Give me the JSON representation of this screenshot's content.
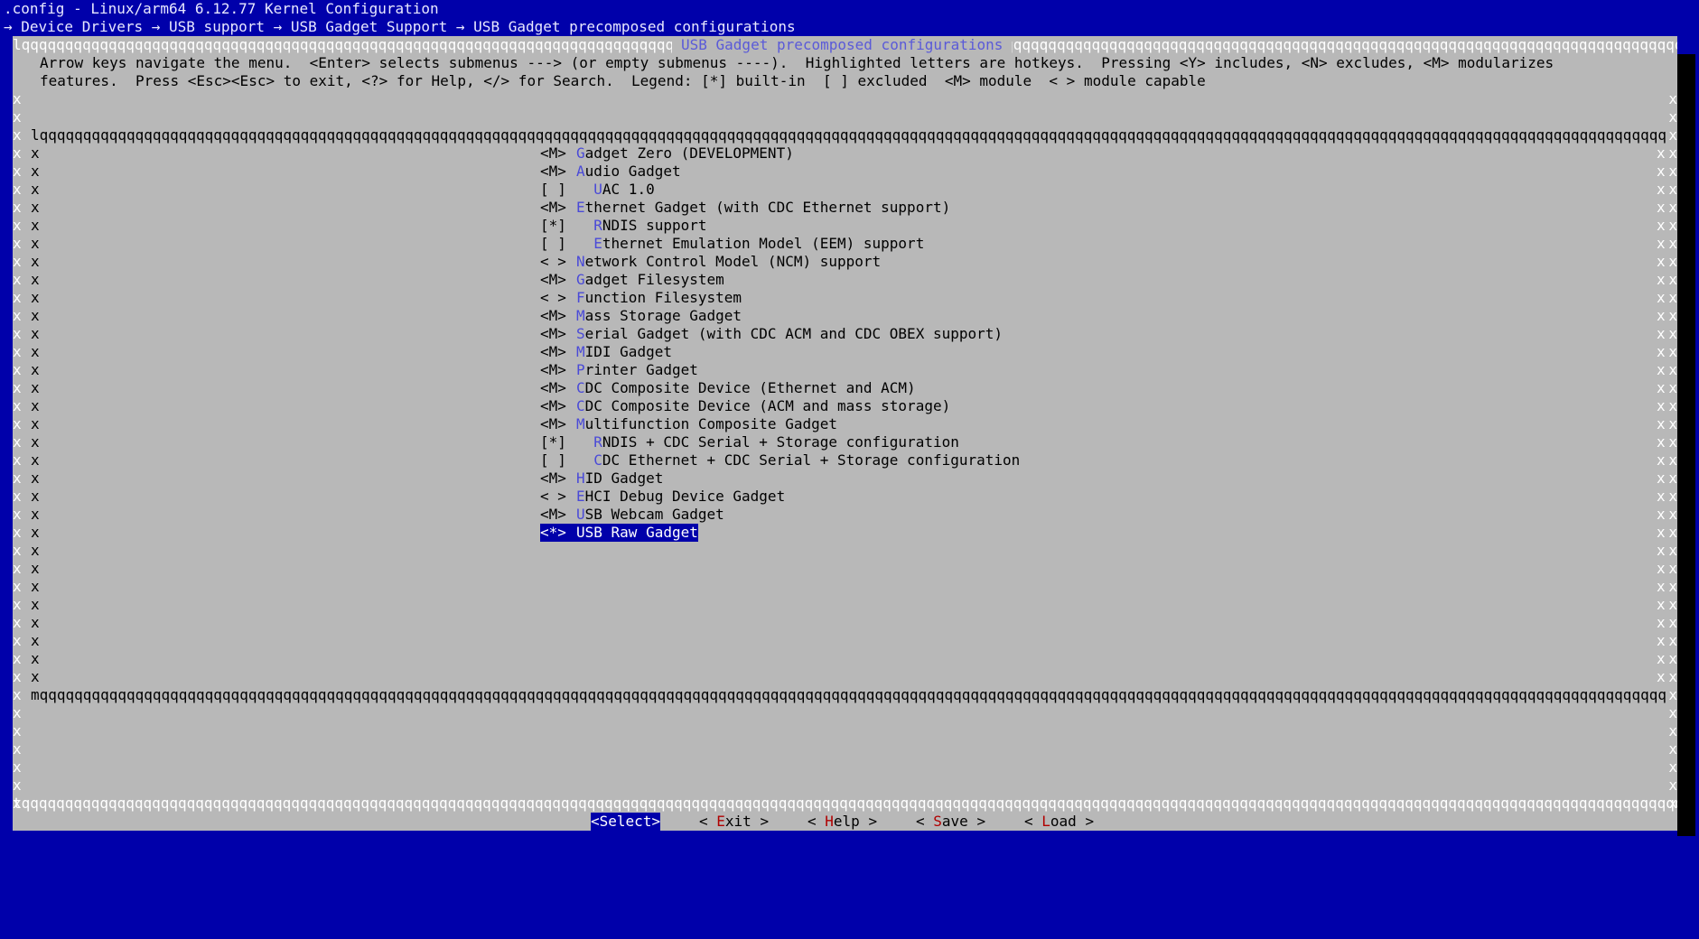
{
  "window": {
    "title": ".config - Linux/arm64 6.12.77 Kernel Configuration",
    "breadcrumb": "→ Device Drivers → USB support → USB Gadget Support → USB Gadget precomposed configurations"
  },
  "dialog": {
    "title": "USB Gadget precomposed configurations",
    "help_line_1": "Arrow keys navigate the menu.  <Enter> selects submenus ---> (or empty submenus ----).  Highlighted letters are hotkeys.  Pressing <Y> includes, <N> excludes, <M> modularizes",
    "help_line_2": "features.  Press <Esc><Esc> to exit, <?> for Help, </> for Search.  Legend: [*] built-in  [ ] excluded  <M> module  < > module capable"
  },
  "menu": {
    "items": [
      {
        "state": "<M>",
        "indent": "",
        "hotkey": "G",
        "rest": "adget Zero (DEVELOPMENT)"
      },
      {
        "state": "<M>",
        "indent": "",
        "hotkey": "A",
        "rest": "udio Gadget"
      },
      {
        "state": "[ ]",
        "indent": "  ",
        "hotkey": "U",
        "rest": "AC 1.0"
      },
      {
        "state": "<M>",
        "indent": "",
        "hotkey": "E",
        "rest": "thernet Gadget (with CDC Ethernet support)"
      },
      {
        "state": "[*]",
        "indent": "  ",
        "hotkey": "R",
        "rest": "NDIS support"
      },
      {
        "state": "[ ]",
        "indent": "  ",
        "hotkey": "E",
        "rest": "thernet Emulation Model (EEM) support"
      },
      {
        "state": "< >",
        "indent": "",
        "hotkey": "N",
        "rest": "etwork Control Model (NCM) support"
      },
      {
        "state": "<M>",
        "indent": "",
        "hotkey": "G",
        "rest": "adget Filesystem"
      },
      {
        "state": "< >",
        "indent": "",
        "hotkey": "F",
        "rest": "unction Filesystem"
      },
      {
        "state": "<M>",
        "indent": "",
        "hotkey": "M",
        "rest": "ass Storage Gadget"
      },
      {
        "state": "<M>",
        "indent": "",
        "hotkey": "S",
        "rest": "erial Gadget (with CDC ACM and CDC OBEX support)"
      },
      {
        "state": "<M>",
        "indent": "",
        "hotkey": "M",
        "rest": "IDI Gadget"
      },
      {
        "state": "<M>",
        "indent": "",
        "hotkey": "P",
        "rest": "rinter Gadget"
      },
      {
        "state": "<M>",
        "indent": "",
        "hotkey": "C",
        "rest": "DC Composite Device (Ethernet and ACM)"
      },
      {
        "state": "<M>",
        "indent": "",
        "hotkey": "C",
        "rest": "DC Composite Device (ACM and mass storage)"
      },
      {
        "state": "<M>",
        "indent": "",
        "hotkey": "M",
        "rest": "ultifunction Composite Gadget"
      },
      {
        "state": "[*]",
        "indent": "  ",
        "hotkey": "R",
        "rest": "NDIS + CDC Serial + Storage configuration"
      },
      {
        "state": "[ ]",
        "indent": "  ",
        "hotkey": "C",
        "rest": "DC Ethernet + CDC Serial + Storage configuration"
      },
      {
        "state": "<M>",
        "indent": "",
        "hotkey": "H",
        "rest": "ID Gadget"
      },
      {
        "state": "< >",
        "indent": "",
        "hotkey": "E",
        "rest": "HCI Debug Device Gadget"
      },
      {
        "state": "<M>",
        "indent": "",
        "hotkey": "U",
        "rest": "SB Webcam Gadget"
      },
      {
        "state": "<*>",
        "indent": "",
        "hotkey": "U",
        "rest": "SB Raw Gadget"
      }
    ],
    "selected_index": 21
  },
  "buttons": {
    "select": {
      "pre": "<",
      "hotkey": "S",
      "post": "elect>"
    },
    "exit": {
      "pre": "< ",
      "hotkey": "E",
      "post": "xit >"
    },
    "help": {
      "pre": "< ",
      "hotkey": "H",
      "post": "elp >"
    },
    "save": {
      "pre": "< ",
      "hotkey": "S",
      "post": "ave >"
    },
    "load": {
      "pre": "< ",
      "hotkey": "L",
      "post": "oad >"
    }
  },
  "colors": {
    "background": "#0000aa",
    "dialog": "#b8b8b8",
    "hotkey_menu": "#4a4ad8",
    "hotkey_button": "#b00000"
  }
}
